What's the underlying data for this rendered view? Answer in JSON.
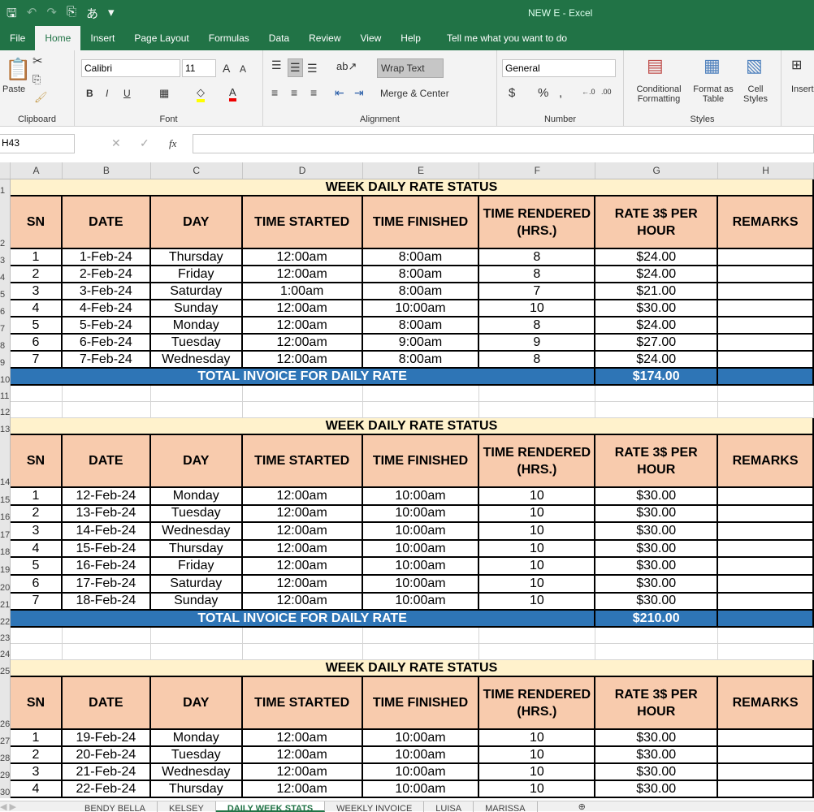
{
  "app": {
    "doc_title": "NEW E  -  Excel"
  },
  "menu_tabs": [
    "File",
    "Home",
    "Insert",
    "Page Layout",
    "Formulas",
    "Data",
    "Review",
    "View",
    "Help"
  ],
  "tell_me": "Tell me what you want to do",
  "ribbon": {
    "paste": "Paste",
    "clipboard": "Clipboard",
    "font_name": "Calibri",
    "font_size": "11",
    "font": "Font",
    "wrap_text": "Wrap Text",
    "merge_center": "Merge & Center",
    "alignment": "Alignment",
    "number_format": "General",
    "number": "Number",
    "currency": "$",
    "percent": "%",
    "comma": ",",
    "conditional_formatting": "Conditional Formatting",
    "format_as_table": "Format as Table",
    "cell_styles": "Cell Styles",
    "styles": "Styles",
    "insert": "Insert",
    "bold": "B",
    "italic": "I",
    "underline": "U"
  },
  "formula_bar": {
    "name_box": "H43",
    "fx": "fx",
    "value": ""
  },
  "columns": [
    "A",
    "B",
    "C",
    "D",
    "E",
    "F",
    "G",
    "H"
  ],
  "headers": [
    "SN",
    "DATE",
    "DAY",
    "TIME STARTED",
    "TIME FINISHED",
    "TIME RENDERED (HRS.)",
    "RATE 3$ PER HOUR",
    "REMARKS"
  ],
  "blocks": [
    {
      "title": "WEEK DAILY RATE STATUS",
      "rows": [
        [
          "1",
          "1-Feb-24",
          "Thursday",
          "12:00am",
          "8:00am",
          "8",
          "$24.00",
          ""
        ],
        [
          "2",
          "2-Feb-24",
          "Friday",
          "12:00am",
          "8:00am",
          "8",
          "$24.00",
          ""
        ],
        [
          "3",
          "3-Feb-24",
          "Saturday",
          "1:00am",
          "8:00am",
          "7",
          "$21.00",
          ""
        ],
        [
          "4",
          "4-Feb-24",
          "Sunday",
          "12:00am",
          "10:00am",
          "10",
          "$30.00",
          ""
        ],
        [
          "5",
          "5-Feb-24",
          "Monday",
          "12:00am",
          "8:00am",
          "8",
          "$24.00",
          ""
        ],
        [
          "6",
          "6-Feb-24",
          "Tuesday",
          "12:00am",
          "9:00am",
          "9",
          "$27.00",
          ""
        ],
        [
          "7",
          "7-Feb-24",
          "Wednesday",
          "12:00am",
          "8:00am",
          "8",
          "$24.00",
          ""
        ]
      ],
      "total_label": "TOTAL INVOICE FOR DAILY RATE",
      "total": "$174.00"
    },
    {
      "title": "WEEK DAILY RATE STATUS",
      "rows": [
        [
          "1",
          "12-Feb-24",
          "Monday",
          "12:00am",
          "10:00am",
          "10",
          "$30.00",
          ""
        ],
        [
          "2",
          "13-Feb-24",
          "Tuesday",
          "12:00am",
          "10:00am",
          "10",
          "$30.00",
          ""
        ],
        [
          "3",
          "14-Feb-24",
          "Wednesday",
          "12:00am",
          "10:00am",
          "10",
          "$30.00",
          ""
        ],
        [
          "4",
          "15-Feb-24",
          "Thursday",
          "12:00am",
          "10:00am",
          "10",
          "$30.00",
          ""
        ],
        [
          "5",
          "16-Feb-24",
          "Friday",
          "12:00am",
          "10:00am",
          "10",
          "$30.00",
          ""
        ],
        [
          "6",
          "17-Feb-24",
          "Saturday",
          "12:00am",
          "10:00am",
          "10",
          "$30.00",
          ""
        ],
        [
          "7",
          "18-Feb-24",
          "Sunday",
          "12:00am",
          "10:00am",
          "10",
          "$30.00",
          ""
        ]
      ],
      "total_label": "TOTAL INVOICE FOR DAILY RATE",
      "total": "$210.00"
    },
    {
      "title": "WEEK DAILY RATE STATUS",
      "rows": [
        [
          "1",
          "19-Feb-24",
          "Monday",
          "12:00am",
          "10:00am",
          "10",
          "$30.00",
          ""
        ],
        [
          "2",
          "20-Feb-24",
          "Tuesday",
          "12:00am",
          "10:00am",
          "10",
          "$30.00",
          ""
        ],
        [
          "3",
          "21-Feb-24",
          "Wednesday",
          "12:00am",
          "10:00am",
          "10",
          "$30.00",
          ""
        ],
        [
          "4",
          "22-Feb-24",
          "Thursday",
          "12:00am",
          "10:00am",
          "10",
          "$30.00",
          ""
        ]
      ]
    }
  ],
  "sheet_tabs": [
    "BENDY BELLA",
    "KELSEY",
    "DAILY WEEK STATS",
    "WEEKLY INVOICE",
    "LUISA",
    "MARISSA"
  ],
  "active_sheet": "DAILY WEEK STATS"
}
